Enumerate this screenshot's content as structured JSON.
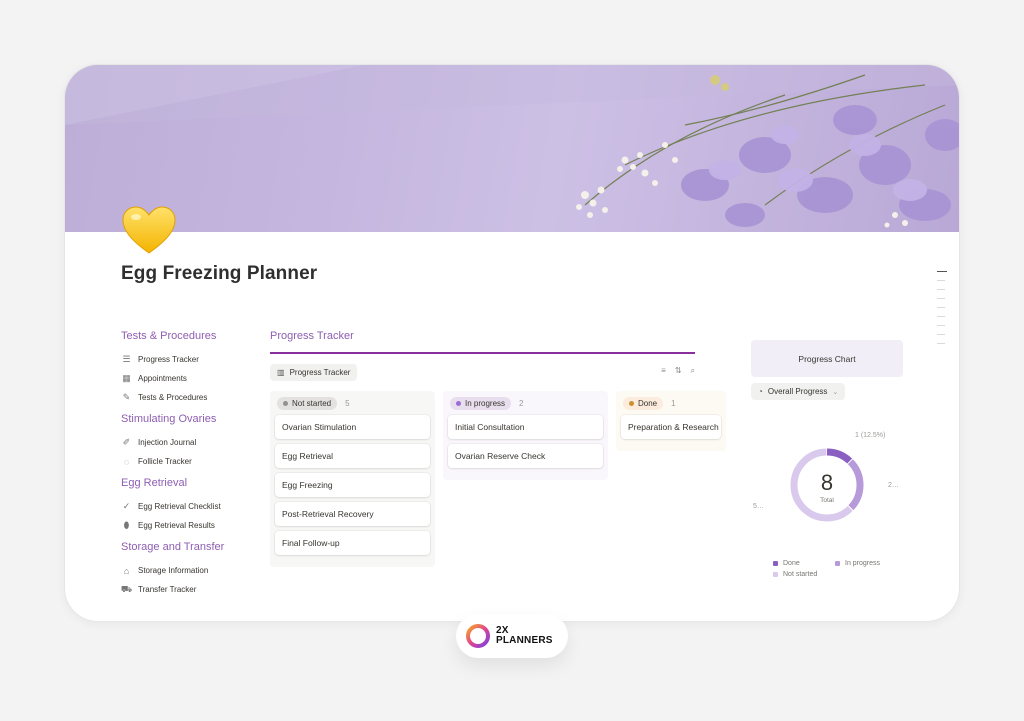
{
  "page": {
    "title": "Egg Freezing Planner",
    "icon": "yellow-heart-icon"
  },
  "sidebar": {
    "sections": [
      {
        "heading": "Tests & Procedures",
        "items": [
          {
            "label": "Progress Tracker",
            "icon": "checklist-icon"
          },
          {
            "label": "Appointments",
            "icon": "calendar-icon"
          },
          {
            "label": "Tests & Procedures",
            "icon": "pencil-icon"
          }
        ]
      },
      {
        "heading": "Stimulating Ovaries",
        "items": [
          {
            "label": "Injection Journal",
            "icon": "syringe-icon"
          },
          {
            "label": "Follicle Tracker",
            "icon": "dashed-circle-icon"
          }
        ]
      },
      {
        "heading": "Egg Retrieval",
        "items": [
          {
            "label": "Egg Retrieval Checklist",
            "icon": "check-icon"
          },
          {
            "label": "Egg Retrieval Results",
            "icon": "egg-icon"
          }
        ]
      },
      {
        "heading": "Storage and Transfer",
        "items": [
          {
            "label": "Storage Information",
            "icon": "home-icon"
          },
          {
            "label": "Transfer Tracker",
            "icon": "car-icon"
          }
        ]
      }
    ]
  },
  "tracker": {
    "title": "Progress Tracker",
    "view_label": "Progress Tracker",
    "columns": [
      {
        "status": "Not started",
        "count": "5",
        "tag_bg": "#e3e2e0",
        "dot": "#91918e",
        "col_bg": "#f7f7f5",
        "cards": [
          "Ovarian Stimulation",
          "Egg Retrieval",
          "Egg Freezing",
          "Post-Retrieval Recovery",
          "Final Follow-up"
        ]
      },
      {
        "status": "In progress",
        "count": "2",
        "tag_bg": "#e8deee",
        "dot": "#9a6dd7",
        "col_bg": "#f9f7fb",
        "cards": [
          "Initial Consultation",
          "Ovarian Reserve Check"
        ]
      },
      {
        "status": "Done",
        "count": "1",
        "tag_bg": "#fbecdd",
        "dot": "#cb912f",
        "col_bg": "#fcfaf2",
        "cards": [
          "Preparation & Research"
        ]
      }
    ]
  },
  "chart": {
    "title": "Progress Chart",
    "view_label": "Overall Progress",
    "total_value": "8",
    "total_label": "Total",
    "labels": {
      "done": "1 (12.5%)",
      "in_progress": "2…",
      "not_started": "5…"
    },
    "legend": [
      "Done",
      "In progress",
      "Not started"
    ]
  },
  "chart_data": {
    "type": "pie",
    "categories": [
      "Done",
      "In progress",
      "Not started"
    ],
    "values": [
      1,
      2,
      5
    ],
    "colors": [
      "#8a5fc2",
      "#b69ad9",
      "#d9c9ec"
    ]
  },
  "brand": {
    "line1": "2X",
    "line2": "PLANNERS"
  },
  "colors": {
    "accent": "#8e5fb2",
    "accent_line": "#8a2f9e",
    "cover": "#c4b6de"
  }
}
